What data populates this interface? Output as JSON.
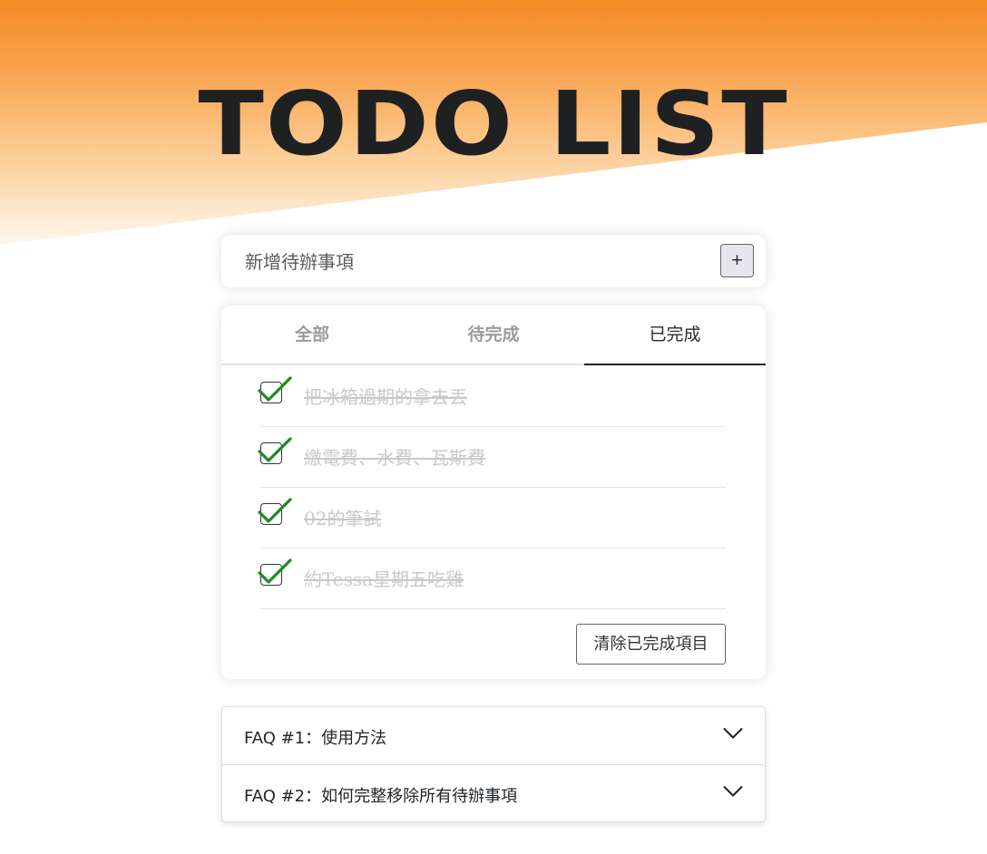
{
  "header": {
    "title": "TODO LIST"
  },
  "add_todo": {
    "placeholder": "新增待辦事項",
    "add_button_label": "+"
  },
  "tabs": [
    {
      "label": "全部",
      "active": false
    },
    {
      "label": "待完成",
      "active": false
    },
    {
      "label": "已完成",
      "active": true
    }
  ],
  "todos": [
    {
      "text": "把冰箱過期的拿去丟",
      "completed": true
    },
    {
      "text": "繳電費、水費、瓦斯費",
      "completed": true
    },
    {
      "text": "02的筆試",
      "completed": true
    },
    {
      "text": "約Tessa星期五吃雞",
      "completed": true
    }
  ],
  "clear_button_label": "清除已完成項目",
  "faq": [
    {
      "title": "FAQ #1：使用方法",
      "icon": "chevron-down-icon"
    },
    {
      "title": "FAQ #2：如何完整移除所有待辦事項",
      "icon": "chevron-down-icon"
    }
  ],
  "colors": {
    "accent_orange": "#f68b22",
    "check_green": "#1f8a1f",
    "completed_text": "#c9c9c9"
  }
}
